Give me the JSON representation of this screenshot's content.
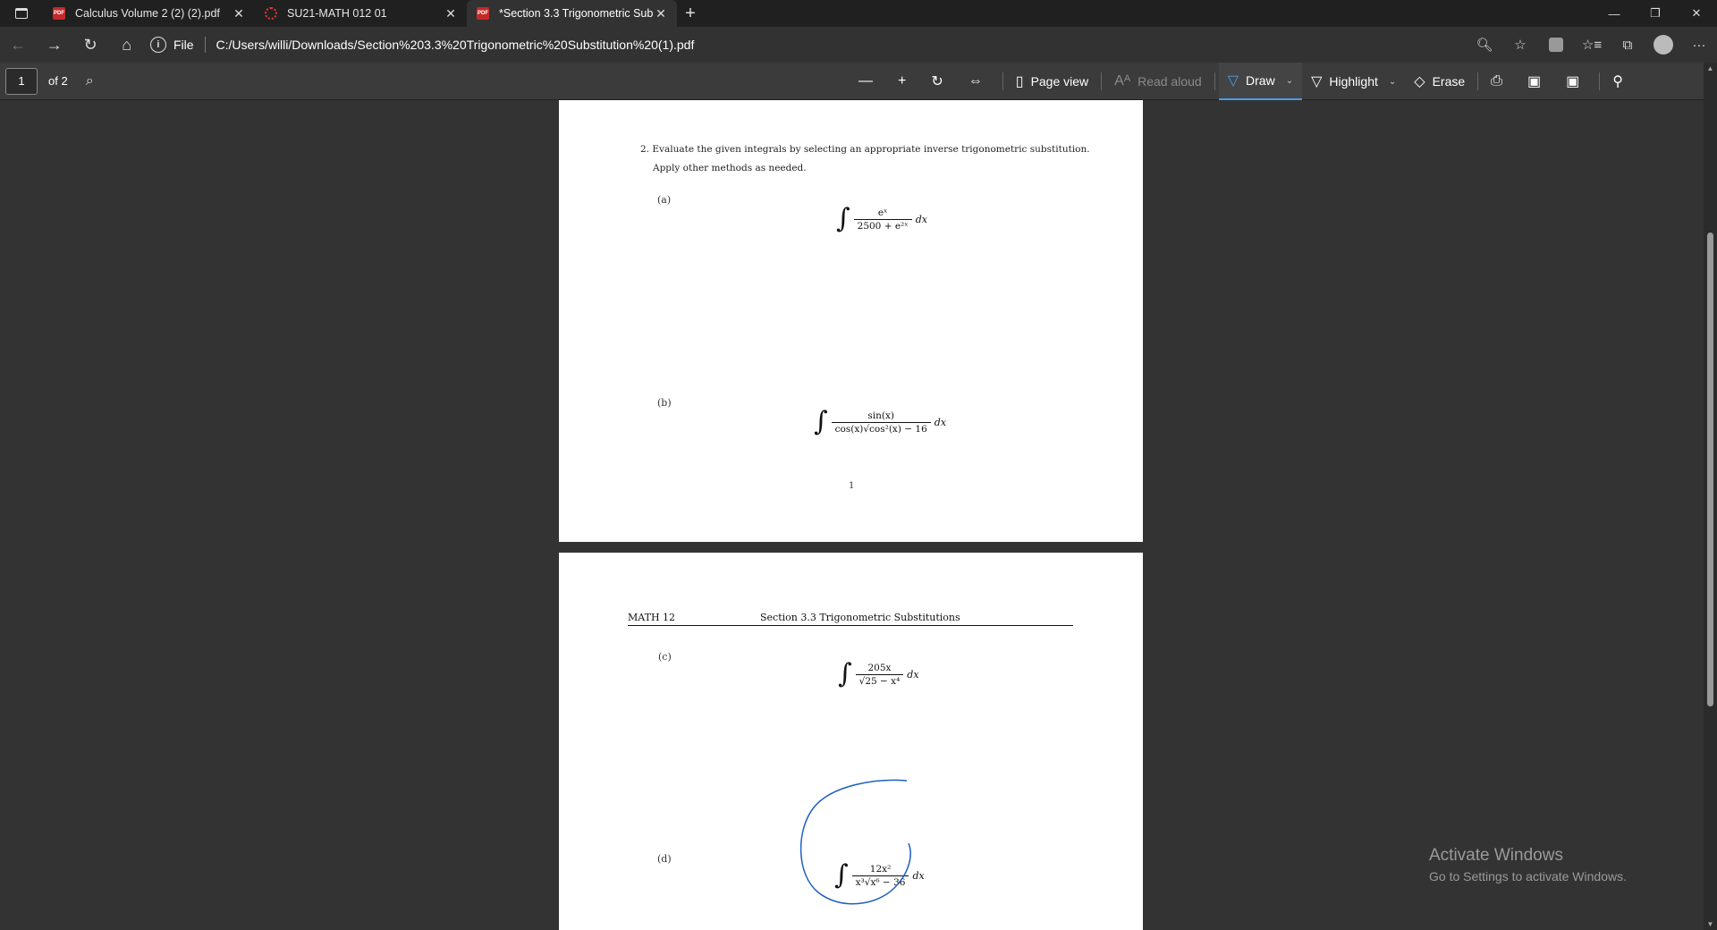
{
  "tabs": [
    {
      "title": "Calculus Volume 2 (2) (2).pdf",
      "icon": "pdf-icon",
      "active": false
    },
    {
      "title": "SU21-MATH 012 01",
      "icon": "loading-spinner-icon",
      "active": false
    },
    {
      "title": "*Section 3.3 Trigonometric Subst",
      "icon": "pdf-icon",
      "active": true
    }
  ],
  "address": {
    "scheme_label": "File",
    "url": "C:/Users/willi/Downloads/Section%203.3%20Trigonometric%20Substitution%20(1).pdf"
  },
  "pdf_toolbar": {
    "page_number": "1",
    "page_total": "of 2",
    "page_view_label": "Page view",
    "read_aloud_label": "Read aloud",
    "draw_label": "Draw",
    "highlight_label": "Highlight",
    "erase_label": "Erase",
    "draw_color": "#4c9be8"
  },
  "document": {
    "page1": {
      "question_line1": "2. Evaluate the given integrals by selecting an appropriate inverse trigonometric substitution.",
      "question_line2": "Apply other methods as needed.",
      "part_a_label": "(a)",
      "part_a_num": "eˣ",
      "part_a_den": "2500 + e²ˣ",
      "part_b_label": "(b)",
      "part_b_num": "sin(x)",
      "part_b_den": "cos(x)√cos²(x) − 16",
      "dx": "dx",
      "page_number": "1"
    },
    "page2": {
      "header_left": "MATH 12",
      "header_center": "Section 3.3 Trigonometric Substitutions",
      "part_c_label": "(c)",
      "part_c_num": "205x",
      "part_c_den": "√25 − x⁴",
      "part_d_label": "(d)",
      "part_d_num": "12x²",
      "part_d_den": "x³√x⁶ − 36",
      "dx": "dx"
    }
  },
  "watermark": {
    "line1": "Activate Windows",
    "line2": "Go to Settings to activate Windows."
  }
}
